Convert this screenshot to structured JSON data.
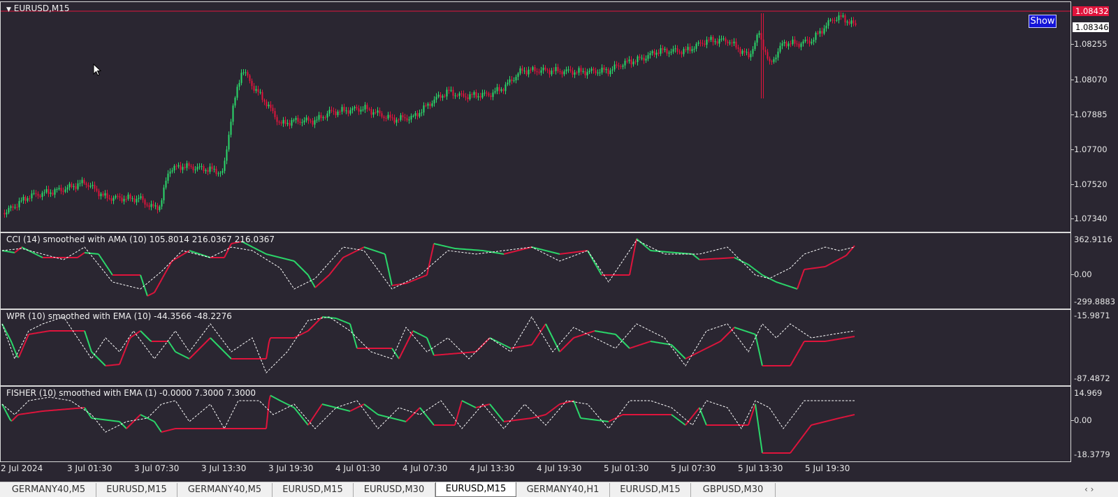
{
  "main": {
    "title": "EURUSD,M15",
    "price_levels": [
      "1.08255",
      "1.08070",
      "1.07885",
      "1.07700",
      "1.07520",
      "1.07340"
    ],
    "ask_price": "1.08432",
    "bid_price": "1.08346",
    "show_button": "Show"
  },
  "indicators": [
    {
      "title": "CCI (14) smoothed with AMA (10) 105.8014 216.0367 216.0367",
      "levels": [
        "362.9116",
        "0.00",
        "-299.8883"
      ]
    },
    {
      "title": "WPR (10) smoothed with EMA (10) -44.3566 -48.2276",
      "levels": [
        "-15.9871",
        "-87.4872"
      ]
    },
    {
      "title": "FISHER (10) smoothed with EMA (1) -0.0000 7.3000 7.3000",
      "levels": [
        "14.969",
        "0.00",
        "-18.3779"
      ]
    }
  ],
  "time_axis": [
    "2 Jul 2024",
    "3 Jul 01:30",
    "3 Jul 07:30",
    "3 Jul 13:30",
    "3 Jul 19:30",
    "4 Jul 01:30",
    "4 Jul 07:30",
    "4 Jul 13:30",
    "4 Jul 19:30",
    "5 Jul 01:30",
    "5 Jul 07:30",
    "5 Jul 13:30",
    "5 Jul 19:30"
  ],
  "tabs": [
    {
      "label": "GERMANY40,M5",
      "active": false
    },
    {
      "label": "EURUSD,M15",
      "active": false
    },
    {
      "label": "GERMANY40,M5",
      "active": false
    },
    {
      "label": "EURUSD,M15",
      "active": false
    },
    {
      "label": "EURUSD,M30",
      "active": false
    },
    {
      "label": "EURUSD,M15",
      "active": true
    },
    {
      "label": "GERMANY40,H1",
      "active": false
    },
    {
      "label": "EURUSD,M15",
      "active": false
    },
    {
      "label": "GBPUSD,M30",
      "active": false
    }
  ],
  "colors": {
    "background": "#2a2631",
    "bull": "#2bd96b",
    "bear": "#e0143c",
    "ask_line": "#e0143c",
    "signal": "#ffffff"
  },
  "icons": [
    "dropdown-triangle-icon",
    "mouse-cursor-icon",
    "tabs-scroll-icon"
  ]
}
